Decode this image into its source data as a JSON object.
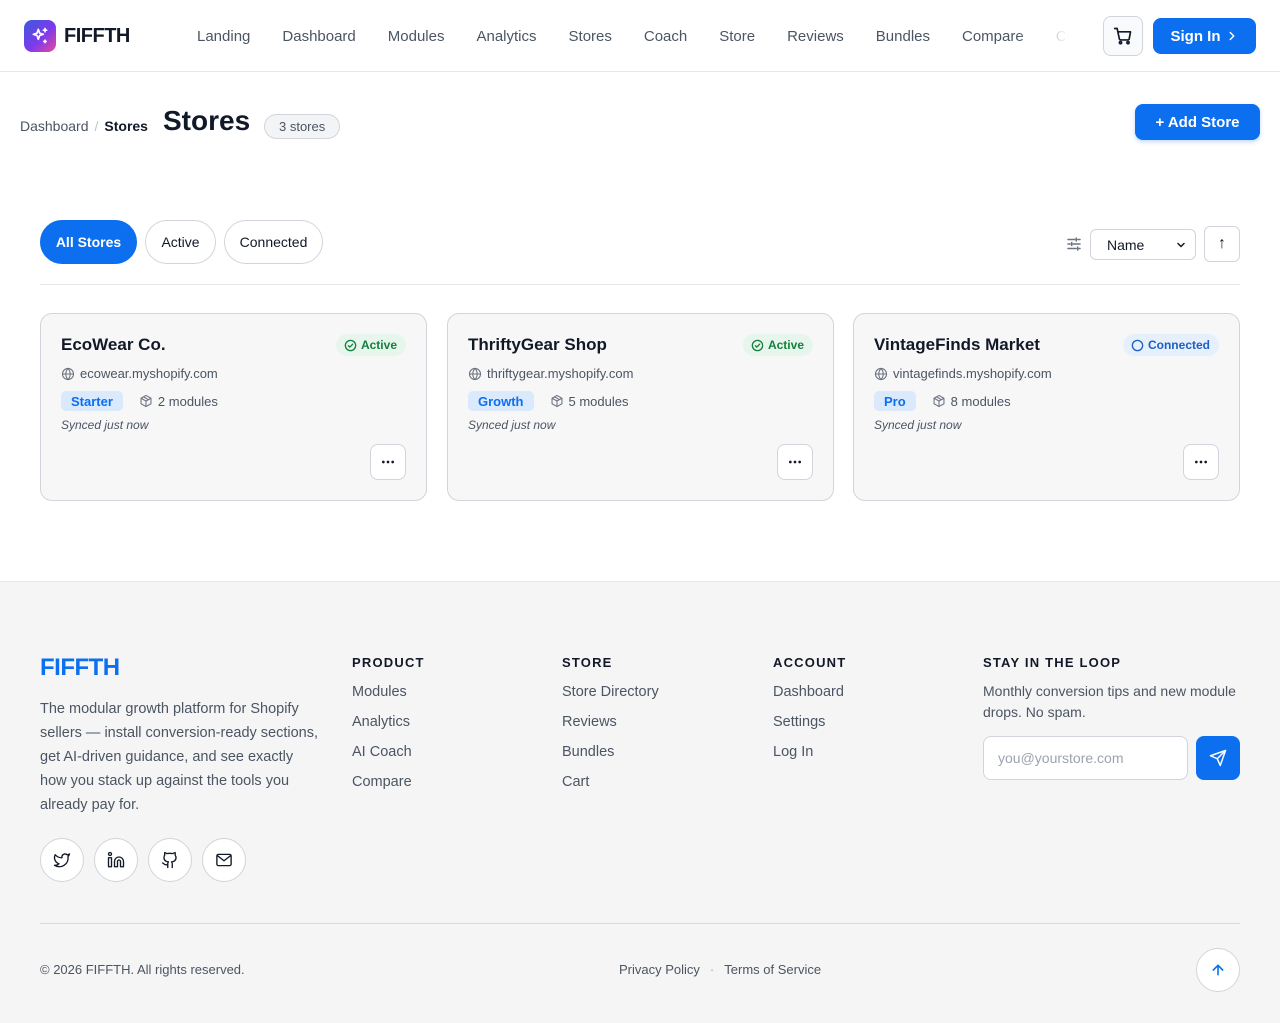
{
  "header": {
    "brand": "FIFFTH",
    "nav": [
      "Landing",
      "Dashboard",
      "Modules",
      "Analytics",
      "Stores",
      "Coach",
      "Store",
      "Reviews",
      "Bundles",
      "Compare",
      "Cart"
    ],
    "sign_in": "Sign In",
    "icons": {
      "logo": "sparkle-icon",
      "cart": "shopping-cart-icon",
      "sign_in_chevron": "chevron-right-icon"
    }
  },
  "page": {
    "breadcrumb": {
      "parent": "Dashboard",
      "separator": "/",
      "current": "Stores"
    },
    "title": "Stores",
    "count_badge": "3 stores",
    "add_button": "+ Add Store"
  },
  "filters": {
    "tabs": [
      "All Stores",
      "Active",
      "Connected"
    ],
    "selected_tab": "All Stores",
    "sort_value": "Name",
    "sort_direction": "↑",
    "icons": {
      "filter": "sliders-icon"
    }
  },
  "stores": [
    {
      "name": "EcoWear Co.",
      "status": "Active",
      "domain": "ecowear.myshopify.com",
      "plan": "Starter",
      "modules": "2 modules",
      "synced": "Synced just now"
    },
    {
      "name": "ThriftyGear Shop",
      "status": "Active",
      "domain": "thriftygear.myshopify.com",
      "plan": "Growth",
      "modules": "5 modules",
      "synced": "Synced just now"
    },
    {
      "name": "VintageFinds Market",
      "status": "Connected",
      "domain": "vintagefinds.myshopify.com",
      "plan": "Pro",
      "modules": "8 modules",
      "synced": "Synced just now"
    }
  ],
  "footer": {
    "brand": "FIFFTH",
    "description": "The modular growth platform for Shopify sellers — install conversion-ready sections, get AI-driven guidance, and see exactly how you stack up against the tools you already pay for.",
    "social": [
      "twitter-icon",
      "linkedin-icon",
      "github-icon",
      "mail-icon"
    ],
    "columns": [
      {
        "title": "PRODUCT",
        "links": [
          "Modules",
          "Analytics",
          "AI Coach",
          "Compare"
        ]
      },
      {
        "title": "STORE",
        "links": [
          "Store Directory",
          "Reviews",
          "Bundles",
          "Cart"
        ]
      },
      {
        "title": "ACCOUNT",
        "links": [
          "Dashboard",
          "Settings",
          "Log In"
        ]
      }
    ],
    "newsletter": {
      "title": "STAY IN THE LOOP",
      "text": "Monthly conversion tips and new module drops. No spam.",
      "placeholder": "you@yourstore.com",
      "send_icon": "send-icon"
    },
    "copyright": "© 2026 FIFFTH. All rights reserved.",
    "legal": [
      "Privacy Policy",
      "Terms of Service"
    ],
    "legal_separator": "·",
    "back_to_top_icon": "arrow-up-icon"
  },
  "colors": {
    "accent": "#0b6ff0",
    "active_status": "#15803d",
    "connected_status": "#1d5fc2",
    "plan_badge_bg": "#dbe9fc"
  }
}
